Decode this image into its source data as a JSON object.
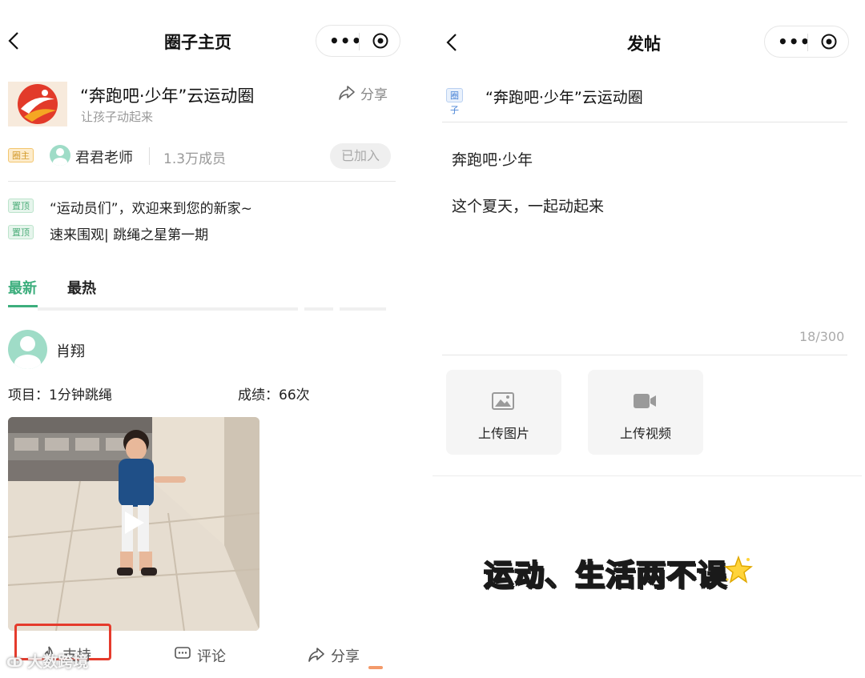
{
  "left": {
    "nav": {
      "title": "圈子主页",
      "more": "•••"
    },
    "circle": {
      "name": "“奔跑吧·少年”云运动圈",
      "subtitle": "让孩子动起来",
      "share_label": "分享",
      "owner_tag": "圈主",
      "owner_name": "君君老师",
      "members": "1.3万成员",
      "join_status": "已加入"
    },
    "pinned": [
      {
        "tag": "置顶",
        "text": "“运动员们”，欢迎来到您的新家~"
      },
      {
        "tag": "置顶",
        "text": "速来围观| 跳绳之星第一期"
      }
    ],
    "tabs": [
      {
        "label": "最新",
        "active": true
      },
      {
        "label": "最热",
        "active": false
      }
    ],
    "post": {
      "author": "肖翔",
      "project": "项目：1分钟跳绳",
      "score": "成绩：66次",
      "actions": {
        "like": "支持",
        "comment": "评论",
        "share": "分享"
      }
    },
    "highlight_color": "#e53b2c"
  },
  "right": {
    "nav": {
      "title": "发帖",
      "more": "•••"
    },
    "circle_tag": "圈子",
    "circle_name": "“奔跑吧·少年”云运动圈",
    "post_title": "奔跑吧·少年",
    "post_body": "这个夏天，一起动起来",
    "char_count": "18/300",
    "upload_image": "上传图片",
    "upload_video": "上传视频"
  },
  "overlay": {
    "slogan": "运动、生活两不误",
    "watermark": "大数跨境"
  },
  "colors": {
    "accent": "#3dae7d",
    "gray_text": "#999999"
  }
}
